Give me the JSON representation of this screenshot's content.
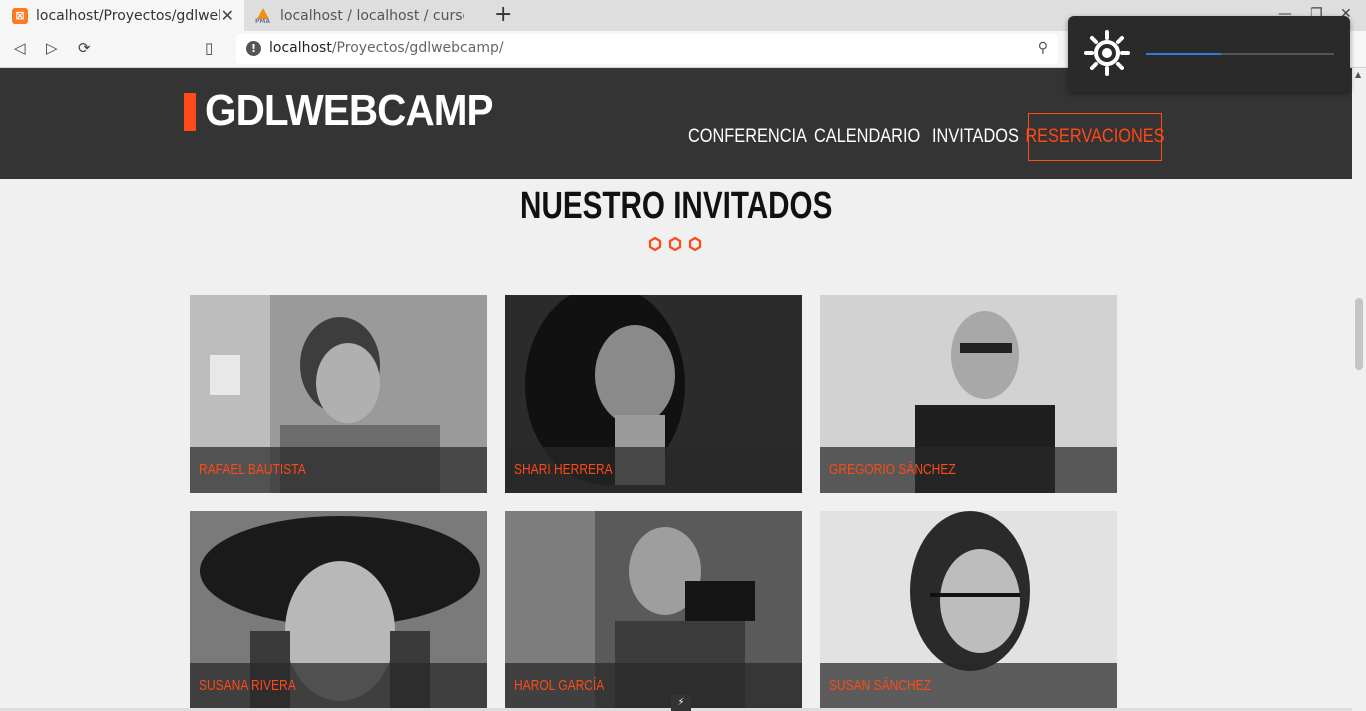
{
  "browser": {
    "tabs": [
      {
        "title": "localhost/Proyectos/gdlwebc",
        "favicon": "xampp-icon",
        "active": true
      },
      {
        "title": "localhost / localhost / cursosnu",
        "favicon": "phpmyadmin-icon",
        "active": false
      }
    ],
    "url": {
      "host": "localhost",
      "path": "/Proyectos/gdlwebcamp/"
    },
    "brightness": {
      "level": 0.4
    }
  },
  "site": {
    "logo": "GDLWEBCAMP",
    "nav": {
      "conferencia": "CONFERENCIA",
      "calendario": "CALENDARIO",
      "invitados": "INVITADOS",
      "reservaciones": "RESERVACIONES"
    },
    "section_title": "NUESTRO INVITADOS",
    "guests": [
      {
        "name": "RAFAEL BAUTISTA"
      },
      {
        "name": "SHARI HERRERA"
      },
      {
        "name": "GREGORIO SÁNCHEZ"
      },
      {
        "name": "SUSANA RIVERA"
      },
      {
        "name": "HAROL GARCÍA"
      },
      {
        "name": "SUSAN SÁNCHEZ"
      }
    ]
  },
  "colors": {
    "accent": "#fe4918",
    "header_bg": "#343434",
    "page_bg": "#f0f0f0"
  }
}
